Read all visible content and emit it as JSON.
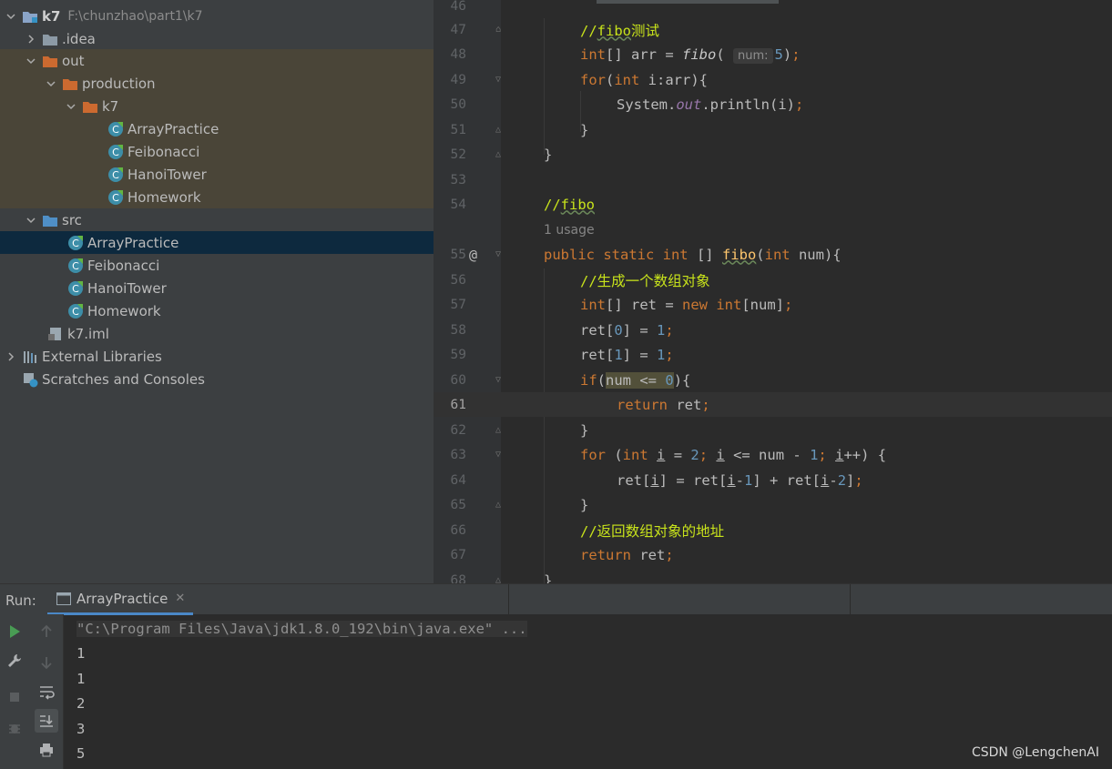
{
  "project_tree": {
    "root": {
      "name": "k7",
      "path": "F:\\chunzhao\\part1\\k7"
    },
    "idea": ".idea",
    "out": "out",
    "production": "production",
    "out_k7": "k7",
    "out_classes": [
      "ArrayPractice",
      "Feibonacci",
      "HanoiTower",
      "Homework"
    ],
    "src": "src",
    "src_classes": [
      "ArrayPractice",
      "Feibonacci",
      "HanoiTower",
      "Homework"
    ],
    "iml": "k7.iml",
    "external_libraries": "External Libraries",
    "scratches": "Scratches and Consoles",
    "selected": "ArrayPractice"
  },
  "editor": {
    "current_line": "61",
    "usage_hint": "1 usage",
    "param_hint": "num:",
    "lines": [
      {
        "n": "46"
      },
      {
        "n": "47",
        "comment_a": "//",
        "comment_b": "fibo",
        "comment_c": "测试"
      },
      {
        "n": "48"
      },
      {
        "n": "49"
      },
      {
        "n": "50"
      },
      {
        "n": "51"
      },
      {
        "n": "52"
      },
      {
        "n": "53"
      },
      {
        "n": "54",
        "comment_a": "//",
        "comment_b": "fibo"
      },
      {
        "n": "55"
      },
      {
        "n": "56",
        "comment": "//生成一个数组对象"
      },
      {
        "n": "57"
      },
      {
        "n": "58"
      },
      {
        "n": "59"
      },
      {
        "n": "60"
      },
      {
        "n": "61"
      },
      {
        "n": "62"
      },
      {
        "n": "63"
      },
      {
        "n": "64"
      },
      {
        "n": "65"
      },
      {
        "n": "66",
        "comment": "//返回数组对象的地址"
      },
      {
        "n": "67"
      },
      {
        "n": "68"
      }
    ]
  },
  "run_panel": {
    "label": "Run:",
    "tab": "ArrayPractice",
    "command": "\"C:\\Program Files\\Java\\jdk1.8.0_192\\bin\\java.exe\" ...",
    "output": [
      "1",
      "1",
      "2",
      "3",
      "5"
    ]
  },
  "watermark": "CSDN @LengchenAI",
  "colors": {
    "keyword": "#cc7832",
    "comment": "#c8e31b",
    "number": "#6897bb",
    "selection": "#0d293e",
    "excluded_bg": "#4a4538"
  }
}
